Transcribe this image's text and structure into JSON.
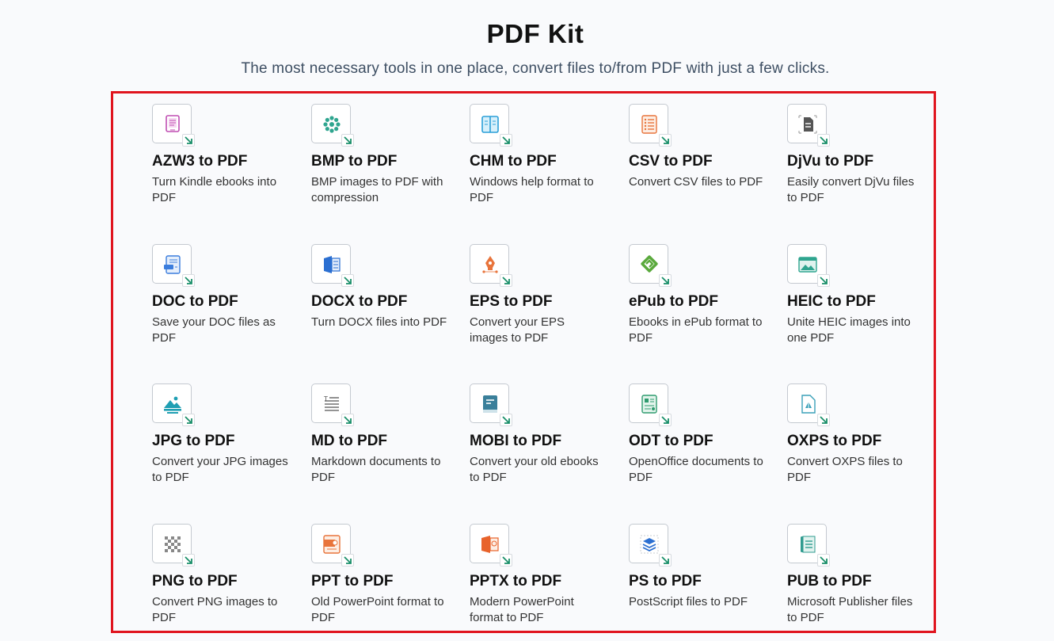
{
  "header": {
    "title": "PDF Kit",
    "subtitle": "The most necessary tools in one place, convert files to/from PDF with just a few clicks."
  },
  "tools": [
    {
      "title": "AZW3 to PDF",
      "desc": "Turn Kindle ebooks into PDF",
      "icon": "kindle-book-icon",
      "color": "#c04fb3"
    },
    {
      "title": "BMP to PDF",
      "desc": "BMP images to PDF with compression",
      "icon": "bmp-image-icon",
      "color": "#2fa58f"
    },
    {
      "title": "CHM to PDF",
      "desc": "Windows help format to PDF",
      "icon": "help-book-icon",
      "color": "#2b9fd8"
    },
    {
      "title": "CSV to PDF",
      "desc": "Convert CSV files to PDF",
      "icon": "csv-list-icon",
      "color": "#e8743b"
    },
    {
      "title": "DjVu to PDF",
      "desc": "Easily convert DjVu files to PDF",
      "icon": "djvu-file-icon",
      "color": "#555555"
    },
    {
      "title": "DOC to PDF",
      "desc": "Save your DOC files as PDF",
      "icon": "doc-file-icon",
      "color": "#3b7ddd"
    },
    {
      "title": "DOCX to PDF",
      "desc": "Turn DOCX files into PDF",
      "icon": "docx-file-icon",
      "color": "#2b6fd1"
    },
    {
      "title": "EPS to PDF",
      "desc": "Convert your EPS images to PDF",
      "icon": "pen-tool-icon",
      "color": "#e8743b"
    },
    {
      "title": "ePub to PDF",
      "desc": "Ebooks in ePub format to PDF",
      "icon": "epub-icon",
      "color": "#5aa93c"
    },
    {
      "title": "HEIC to PDF",
      "desc": "Unite HEIC images into one PDF",
      "icon": "heic-image-icon",
      "color": "#2fa58f"
    },
    {
      "title": "JPG to PDF",
      "desc": "Convert your JPG images to PDF",
      "icon": "jpg-image-icon",
      "color": "#1f9fb3"
    },
    {
      "title": "MD to PDF",
      "desc": "Markdown documents to PDF",
      "icon": "markdown-icon",
      "color": "#555555"
    },
    {
      "title": "MOBI to PDF",
      "desc": "Convert your old ebooks to PDF",
      "icon": "mobi-book-icon",
      "color": "#3a7f9a"
    },
    {
      "title": "ODT to PDF",
      "desc": "OpenOffice documents to PDF",
      "icon": "odt-file-icon",
      "color": "#2f9b6f"
    },
    {
      "title": "OXPS to PDF",
      "desc": "Convert OXPS files to PDF",
      "icon": "oxps-file-icon",
      "color": "#3aa0b8"
    },
    {
      "title": "PNG to PDF",
      "desc": "Convert PNG images to PDF",
      "icon": "png-checker-icon",
      "color": "#888888"
    },
    {
      "title": "PPT to PDF",
      "desc": "Old PowerPoint format to PDF",
      "icon": "ppt-file-icon",
      "color": "#e8743b"
    },
    {
      "title": "PPTX to PDF",
      "desc": "Modern PowerPoint format to PDF",
      "icon": "pptx-file-icon",
      "color": "#e8632b"
    },
    {
      "title": "PS to PDF",
      "desc": "PostScript files to PDF",
      "icon": "postscript-layers-icon",
      "color": "#2b6fd1"
    },
    {
      "title": "PUB to PDF",
      "desc": "Microsoft Publisher files to PDF",
      "icon": "publisher-icon",
      "color": "#2f9b8f"
    }
  ],
  "badge": {
    "icon": "arrow-down-right-icon",
    "color": "#1a8f6a"
  }
}
